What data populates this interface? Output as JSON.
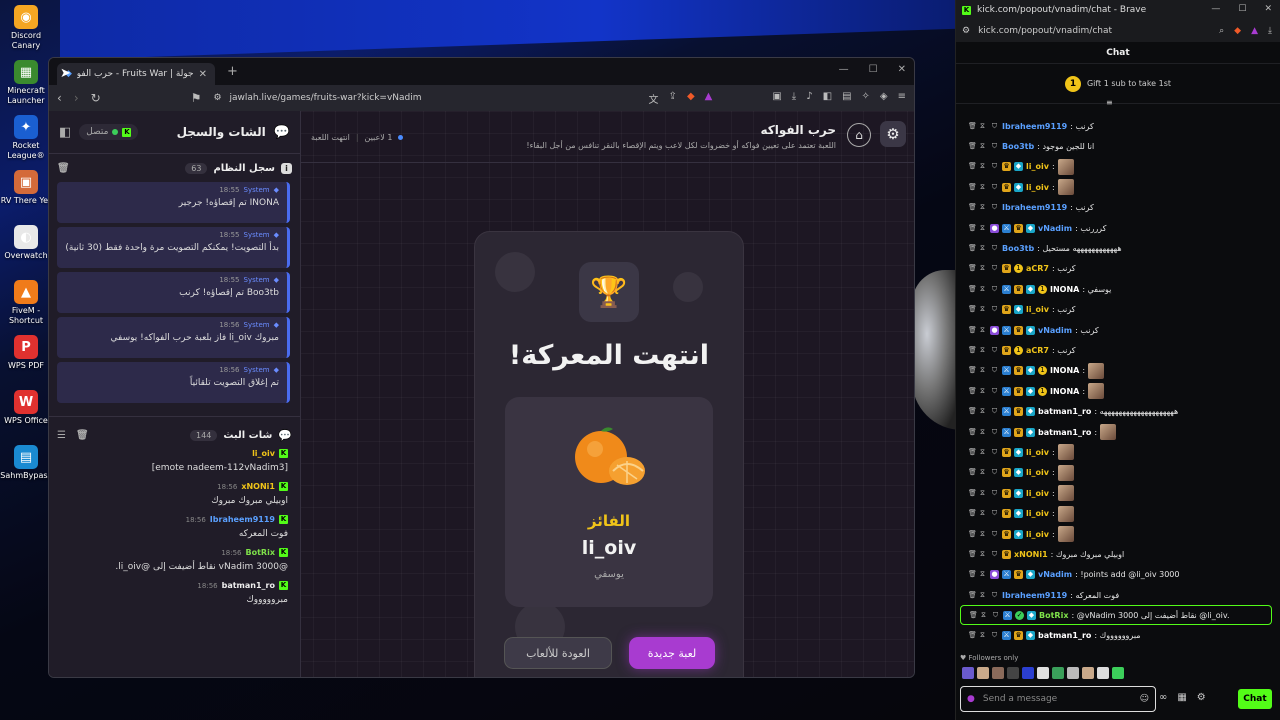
{
  "desktop": {
    "icons": [
      {
        "label": "Discord Canary",
        "color": "#f5a623",
        "glyph": "◉"
      },
      {
        "label": "Minecraft Launcher",
        "color": "#3a8a2e",
        "glyph": "▦"
      },
      {
        "label": "Rocket League®",
        "color": "#1a5fd1",
        "glyph": "✦"
      },
      {
        "label": "RV There Yet",
        "color": "#d46a3a",
        "glyph": "▣"
      },
      {
        "label": "Overwatch",
        "color": "#e8e8e8",
        "glyph": "◐"
      },
      {
        "label": "FiveM - Shortcut",
        "color": "#f07b1a",
        "glyph": "▲"
      },
      {
        "label": "WPS PDF",
        "color": "#e0312f",
        "glyph": "P"
      },
      {
        "label": "WPS Office",
        "color": "#e0312f",
        "glyph": "W"
      },
      {
        "label": "SahmBypass",
        "color": "#1a8ad1",
        "glyph": "▤"
      }
    ]
  },
  "browser": {
    "tab_title": "جولة | Fruits War - حرب الفواكه",
    "url": "jawlah.live/games/fruits-war?kick=vNadim"
  },
  "chat_panel": {
    "title": "الشات والسجل",
    "status": "متصل",
    "system_log": {
      "title": "سجل النظام",
      "count": "63",
      "messages": [
        {
          "time": "18:55",
          "sender": "System",
          "text": "INONA تم إقصاؤه! جرجير"
        },
        {
          "time": "18:55",
          "sender": "System",
          "text": "بدأ التصويت! يمكنكم التصويت مرة واحدة فقط (30 ثانية)"
        },
        {
          "time": "18:55",
          "sender": "System",
          "text": "Boo3tb تم إقصاؤه! كرنب"
        },
        {
          "time": "18:56",
          "sender": "System",
          "text": "مبروك li_oiv فاز بلعبة حرب الفواكه! يوسفي"
        },
        {
          "time": "18:56",
          "sender": "System",
          "text": "تم إغلاق التصويت تلقائياً"
        }
      ]
    },
    "live_chat": {
      "title": "شات البث",
      "count": "144",
      "messages": [
        {
          "time": "",
          "user": "li_oiv",
          "color": "#f0c419",
          "text": "[emote nadeem-112vNadim3]"
        },
        {
          "time": "18:56",
          "user": "xNONi1",
          "color": "#f0c419",
          "text": "اوبيلي مبروك مبروك"
        },
        {
          "time": "18:56",
          "user": "Ibraheem9119",
          "color": "#5aa0ff",
          "text": "فوت المعركه"
        },
        {
          "time": "18:56",
          "user": "BotRix",
          "color": "#7ee04a",
          "text": "@vNadim 3000 نقاط أضيفت إلى @li_oiv."
        },
        {
          "time": "18:56",
          "user": "batman1_ro",
          "color": "#eee",
          "text": "مبروووووك"
        }
      ]
    }
  },
  "game": {
    "title": "حرب الفواكه",
    "description": "اللعبة تعتمد على تعيين فواكه أو خضروات لكل لاعب ويتم الإقصاء بالنقر تنافس من أجل البقاء!",
    "players": "1 لاعبين",
    "game_state": "انتهت اللعبة",
    "end_title": "انتهت المعركة!",
    "winner_label": "الفائز",
    "winner_name": "li_oiv",
    "winner_fruit": "يوسفي",
    "back_button": "العودة للألعاب",
    "new_game_button": "لعبة جديدة"
  },
  "kick": {
    "window_title": "kick.com/popout/vnadim/chat - Brave",
    "url": "kick.com/popout/vnadim/chat",
    "chat_heading": "Chat",
    "gift_text": "Gift 1 sub to take 1st",
    "gift_count": "1",
    "followers_only": "Followers only",
    "input_placeholder": "Send a message",
    "chat_button": "Chat",
    "messages": [
      {
        "badges": [
          "shield"
        ],
        "user": "Ibraheem9119",
        "color": "#5aa0ff",
        "text": ": كرنب",
        "emote": false
      },
      {
        "badges": [
          "shield"
        ],
        "user": "Boo3tb",
        "color": "#5aa0ff",
        "text": ": انا للجين موجود",
        "emote": false
      },
      {
        "badges": [
          "shield",
          "crown",
          "vip"
        ],
        "user": "li_oiv",
        "color": "#f0c419",
        "text": ":",
        "emote": true
      },
      {
        "badges": [
          "shield",
          "crown",
          "vip"
        ],
        "user": "li_oiv",
        "color": "#f0c419",
        "text": ":",
        "emote": true
      },
      {
        "badges": [
          "shield"
        ],
        "user": "Ibraheem9119",
        "color": "#5aa0ff",
        "text": ": كرنب",
        "emote": false
      },
      {
        "badges": [
          "mic",
          "mod",
          "crown",
          "vip"
        ],
        "user": "vNadim",
        "color": "#5aa0ff",
        "text": ": كرررنب",
        "emote": false
      },
      {
        "badges": [
          "shield"
        ],
        "user": "Boo3tb",
        "color": "#5aa0ff",
        "text": ": ههههههههههههه مستحيل",
        "emote": false
      },
      {
        "badges": [
          "shield",
          "crown",
          "coin"
        ],
        "user": "aCR7",
        "color": "#f0c419",
        "text": ": كرنب",
        "emote": false
      },
      {
        "badges": [
          "shield",
          "mod",
          "crown",
          "vip",
          "coin"
        ],
        "user": "INONA",
        "color": "#ffffff",
        "text": ": يوسفي",
        "emote": false
      },
      {
        "badges": [
          "shield",
          "crown",
          "vip"
        ],
        "user": "li_oiv",
        "color": "#f0c419",
        "text": ": كرنب",
        "emote": false
      },
      {
        "badges": [
          "mic",
          "mod",
          "crown",
          "vip"
        ],
        "user": "vNadim",
        "color": "#5aa0ff",
        "text": ": كرنب",
        "emote": false
      },
      {
        "badges": [
          "shield",
          "crown",
          "coin"
        ],
        "user": "aCR7",
        "color": "#f0c419",
        "text": ": كرنب",
        "emote": false
      },
      {
        "badges": [
          "shield",
          "mod",
          "crown",
          "vip",
          "coin"
        ],
        "user": "INONA",
        "color": "#ffffff",
        "text": ":",
        "emote": true
      },
      {
        "badges": [
          "shield",
          "mod",
          "crown",
          "vip",
          "coin"
        ],
        "user": "INONA",
        "color": "#ffffff",
        "text": ":",
        "emote": true
      },
      {
        "badges": [
          "shield",
          "mod",
          "crown",
          "vip"
        ],
        "user": "batman1_ro",
        "color": "#ffffff",
        "text": ": ههههههههههههههههههههه",
        "emote": false
      },
      {
        "badges": [
          "shield",
          "mod",
          "crown",
          "vip"
        ],
        "user": "batman1_ro",
        "color": "#ffffff",
        "text": ":",
        "emote": true
      },
      {
        "badges": [
          "shield",
          "crown",
          "vip"
        ],
        "user": "li_oiv",
        "color": "#f0c419",
        "text": ":",
        "emote": true
      },
      {
        "badges": [
          "shield",
          "crown",
          "vip"
        ],
        "user": "li_oiv",
        "color": "#f0c419",
        "text": ":",
        "emote": true
      },
      {
        "badges": [
          "shield",
          "crown",
          "vip"
        ],
        "user": "li_oiv",
        "color": "#f0c419",
        "text": ":",
        "emote": true
      },
      {
        "badges": [
          "shield",
          "crown",
          "vip"
        ],
        "user": "li_oiv",
        "color": "#f0c419",
        "text": ":",
        "emote": true
      },
      {
        "badges": [
          "shield",
          "crown",
          "vip"
        ],
        "user": "li_oiv",
        "color": "#f0c419",
        "text": ":",
        "emote": true
      },
      {
        "badges": [
          "shield",
          "crown"
        ],
        "user": "xNONi1",
        "color": "#f0c419",
        "text": ": اوبيلي مبروك مبروك",
        "emote": false
      },
      {
        "badges": [
          "mic",
          "mod",
          "crown",
          "vip"
        ],
        "user": "vNadim",
        "color": "#5aa0ff",
        "text": ": !points add @li_oiv 3000",
        "emote": false
      },
      {
        "badges": [
          "shield"
        ],
        "user": "Ibraheem9119",
        "color": "#5aa0ff",
        "text": ": فوت المعركه",
        "emote": false
      },
      {
        "badges": [
          "shield",
          "mod",
          "bot",
          "vip"
        ],
        "user": "BotRix",
        "color": "#7ee04a",
        "text": ": @vNadim 3000 نقاط أضيفت إلى @li_oiv.",
        "emote": false,
        "highlight": true
      },
      {
        "badges": [
          "shield",
          "mod",
          "crown",
          "vip"
        ],
        "user": "batman1_ro",
        "color": "#ffffff",
        "text": ": مبرووووووك",
        "emote": false
      }
    ],
    "emote_bar_colors": [
      "#6a5acd",
      "#c9a98a",
      "#8a6a5a",
      "#444",
      "#2b3fd1",
      "#e0e0e0",
      "#3aa05a",
      "#bbb",
      "#c9a98a",
      "#ddd",
      "#3ccf5a"
    ]
  }
}
